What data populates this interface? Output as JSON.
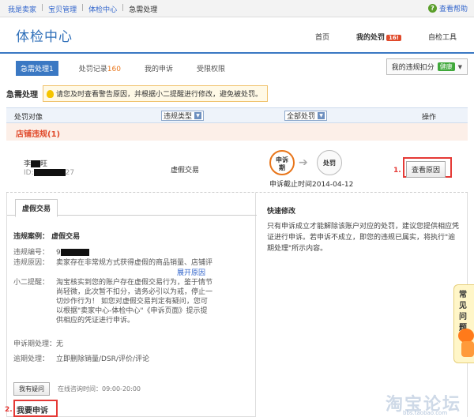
{
  "breadcrumb": {
    "items": [
      "我是卖家",
      "宝贝管理",
      "体检中心",
      "急需处理"
    ],
    "separator": "|",
    "help_label": "查看帮助"
  },
  "header": {
    "title": "体检中心",
    "nav": [
      {
        "label": "首页"
      },
      {
        "label": "我的处罚",
        "badge": "16!"
      },
      {
        "label": "自检工具"
      }
    ]
  },
  "tabs": [
    {
      "label": "急需处理1"
    },
    {
      "label": "处罚记录",
      "count": "160"
    },
    {
      "label": "我的申诉"
    },
    {
      "label": "受限权限"
    }
  ],
  "score": {
    "label": "我的违规扣分",
    "status": "健康"
  },
  "urgent": {
    "title": "急需处理",
    "tip": "请您及时查看警告原因，并根据小二提醒进行修改，避免被处罚。"
  },
  "table": {
    "col_object": "处罚对像",
    "filter_type": "违规类型",
    "filter_all": "全部处罚",
    "col_action": "操作"
  },
  "section": {
    "title": "店铺违规(1)"
  },
  "record": {
    "name_prefix": "李",
    "name_suffix": "旺",
    "id_prefix": "ID:",
    "id_suffix": "27",
    "type": "虚假交易",
    "step1": "申诉期",
    "step1_line1": "申诉",
    "step1_line2": "期",
    "step2": "处罚",
    "deadline": "申诉截止时间2014-04-12",
    "button": "查看原因",
    "marker": "1."
  },
  "detail": {
    "tab": "虚假交易",
    "case_title": "违规案例： 虚假交易",
    "fields": [
      {
        "key": "违规编号：",
        "value": "9"
      },
      {
        "key": "违规原因：",
        "value": "卖家存在非常规方式获得虚假的商品销量、店铺评"
      },
      {
        "key": "小二提醒：",
        "value": "淘宝核实到您的账户存在虚假交易行为，鉴于情节尚轻微，此次暂不扣分，请务必引以为戒，停止一切炒作行为！ 如您对虚假交易判定有疑问，您可以根据\"卖家中心-体检中心\"《申诉页面》提示提供相应的凭证进行申诉。"
      },
      {
        "key": "申诉期处理：",
        "value": "无"
      },
      {
        "key": "逾期处理：",
        "value": "立即删除销量/DSR/评价/评论"
      }
    ],
    "expand_link": "展开原因",
    "ask_button": "我有疑问",
    "online_time": "在线咨询时间：09:00-20:00",
    "appeal": "我要申诉",
    "marker": "2."
  },
  "quick_fix": {
    "title": "快速修改",
    "text": "只有申诉成立才能解除该账户对应的处罚，建议您提供相应凭证进行申诉。若申诉不成立，即您的违规已属实，将执行\"逾期处理\"所示内容。"
  },
  "faq": {
    "label": "常见问题"
  },
  "watermark": {
    "text": "淘宝论坛",
    "sub": "bbs.taobao.com"
  }
}
